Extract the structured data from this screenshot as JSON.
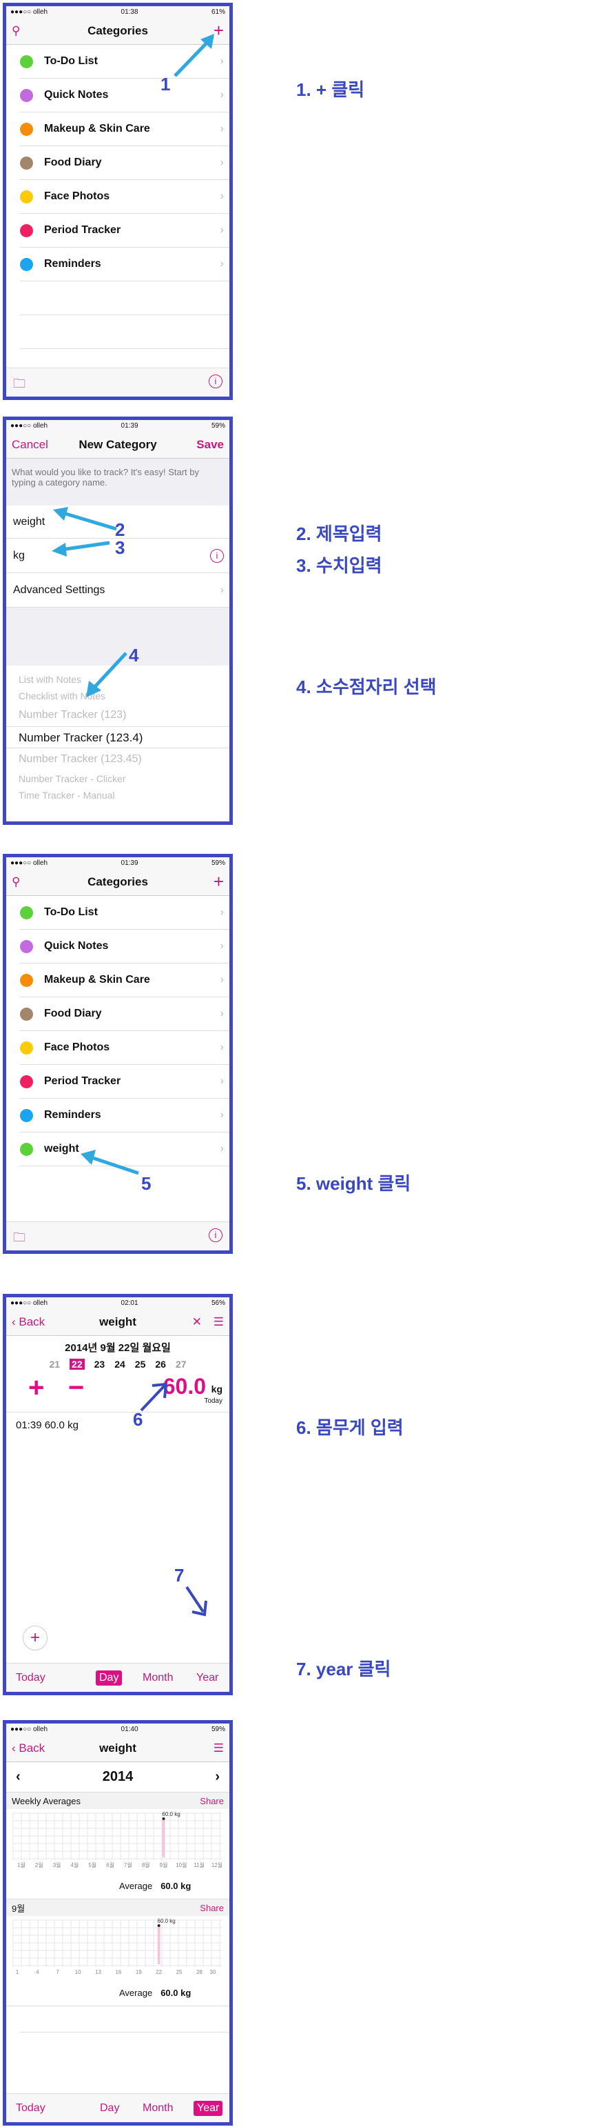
{
  "colors": {
    "accent": "#c2187f",
    "frame": "#4047c2",
    "annotation": "#3a48c0"
  },
  "p1": {
    "status": {
      "carrier": "●●●○○ olleh",
      "time": "01:38",
      "battery": "61%"
    },
    "title": "Categories",
    "add": "+",
    "search_icon": "search-icon",
    "annotation": "1",
    "items": [
      {
        "label": "To-Do List",
        "color": "#5cd13a"
      },
      {
        "label": "Quick Notes",
        "color": "#c36ae0"
      },
      {
        "label": "Makeup & Skin Care",
        "color": "#f58c0a"
      },
      {
        "label": "Food Diary",
        "color": "#a3856a"
      },
      {
        "label": "Face Photos",
        "color": "#f9cb0a"
      },
      {
        "label": "Period Tracker",
        "color": "#ef2062"
      },
      {
        "label": "Reminders",
        "color": "#1ba5ee"
      }
    ]
  },
  "p2": {
    "status": {
      "carrier": "●●●○○ olleh",
      "time": "01:39",
      "battery": "59%"
    },
    "cancel": "Cancel",
    "title": "New Category",
    "save": "Save",
    "hint": "What would you like to track? It's easy! Start by typing a category name.",
    "name_value": "weight",
    "unit_value": "kg",
    "advanced": "Advanced Settings",
    "ann2": "2",
    "ann3": "3",
    "ann4": "4",
    "picker": [
      "List with Notes",
      "Checklist with Notes",
      "Number Tracker (123)",
      "Number Tracker (123.4)",
      "Number Tracker (123.45)",
      "Number Tracker - Clicker",
      "Time Tracker - Manual"
    ],
    "picker_selected": "Number Tracker (123.4)"
  },
  "p3": {
    "status": {
      "carrier": "●●●○○ olleh",
      "time": "01:39",
      "battery": "59%"
    },
    "title": "Categories",
    "add": "+",
    "annotation": "5",
    "items": [
      {
        "label": "To-Do List",
        "color": "#5cd13a"
      },
      {
        "label": "Quick Notes",
        "color": "#c36ae0"
      },
      {
        "label": "Makeup & Skin Care",
        "color": "#f58c0a"
      },
      {
        "label": "Food Diary",
        "color": "#a3856a"
      },
      {
        "label": "Face Photos",
        "color": "#f9cb0a"
      },
      {
        "label": "Period Tracker",
        "color": "#ef2062"
      },
      {
        "label": "Reminders",
        "color": "#1ba5ee"
      },
      {
        "label": "weight",
        "color": "#5cd13a"
      }
    ]
  },
  "p4": {
    "status": {
      "carrier": "●●●○○ olleh",
      "time": "02:01",
      "battery": "56%"
    },
    "back": "Back",
    "title": "weight",
    "date": "2014년 9월 22일 월요일",
    "days": [
      "21",
      "22",
      "23",
      "24",
      "25",
      "26",
      "27"
    ],
    "selected_day": "22",
    "plus": "+",
    "minus": "−",
    "value": "60.0",
    "unit": "kg",
    "today": "Today",
    "entry": "01:39  60.0 kg",
    "ann6": "6",
    "ann7": "7",
    "tabs": {
      "today": "Today",
      "day": "Day",
      "month": "Month",
      "year": "Year"
    }
  },
  "p5": {
    "status": {
      "carrier": "●●●○○ olleh",
      "time": "01:40",
      "battery": "59%"
    },
    "back": "Back",
    "title": "weight",
    "year": "2014",
    "weekly_title": "Weekly Averages",
    "share": "Share",
    "avg_label": "Average",
    "avg_value": "60.0 kg",
    "month_title": "9월",
    "tabs": {
      "today": "Today",
      "day": "Day",
      "month": "Month",
      "year": "Year"
    }
  },
  "steps": [
    "1. + 클릭",
    "2. 제목입력",
    "3. 수치입력",
    "4. 소수점자리 선택",
    "5. weight 클릭",
    "6. 몸무게 입력",
    "7. year 클릭"
  ],
  "chart_data": [
    {
      "type": "scatter",
      "title": "Weekly Averages",
      "categories": [
        "1월",
        "2월",
        "3월",
        "4월",
        "5월",
        "6월",
        "7월",
        "8월",
        "9월",
        "10월",
        "11월",
        "12월"
      ],
      "points": [
        {
          "x": "9월",
          "y": 60.0,
          "label": "60.0 kg"
        }
      ],
      "grid": true
    },
    {
      "type": "scatter",
      "title": "9월",
      "xticks": [
        "1",
        "4",
        "7",
        "10",
        "13",
        "16",
        "19",
        "22",
        "25",
        "28",
        "30"
      ],
      "xlim": [
        1,
        30
      ],
      "points": [
        {
          "x": 22,
          "y": 60.0,
          "label": "60.0 kg"
        }
      ],
      "grid": true
    }
  ]
}
